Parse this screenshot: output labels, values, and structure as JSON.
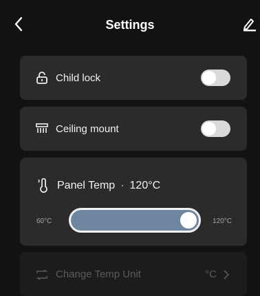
{
  "header": {
    "title": "Settings",
    "back_icon": "chevron-left-icon",
    "edit_icon": "pencil-icon"
  },
  "settings": {
    "child_lock": {
      "label": "Child lock",
      "icon": "lock-icon",
      "enabled": false
    },
    "ceiling_mount": {
      "label": "Ceiling mount",
      "icon": "heater-icon",
      "enabled": false
    }
  },
  "panel_temp": {
    "label": "Panel Temp",
    "separator": "·",
    "value_text": "120°C",
    "icon": "thermometer-icon",
    "min_label": "60°C",
    "max_label": "120°C",
    "level_fraction": 1.0
  },
  "temp_unit": {
    "label": "Change Temp Unit",
    "value": "°C",
    "icon": "swap-icon",
    "chevron_icon": "chevron-right-icon"
  },
  "colors": {
    "background": "#121212",
    "card": "#2b2b2b",
    "slider_fill": "#6e86a0",
    "toggle_off": "#d9d9d9"
  }
}
